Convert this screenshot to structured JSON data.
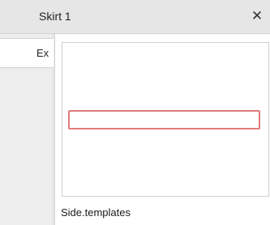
{
  "window": {
    "title": "Skirt 1",
    "close_glyph": "✕",
    "close_icon": "close-icon"
  },
  "sidebar": {
    "tab_label": "Ex"
  },
  "popup": {
    "caption": "Side.templates",
    "outline_color": "#e07b7b"
  }
}
